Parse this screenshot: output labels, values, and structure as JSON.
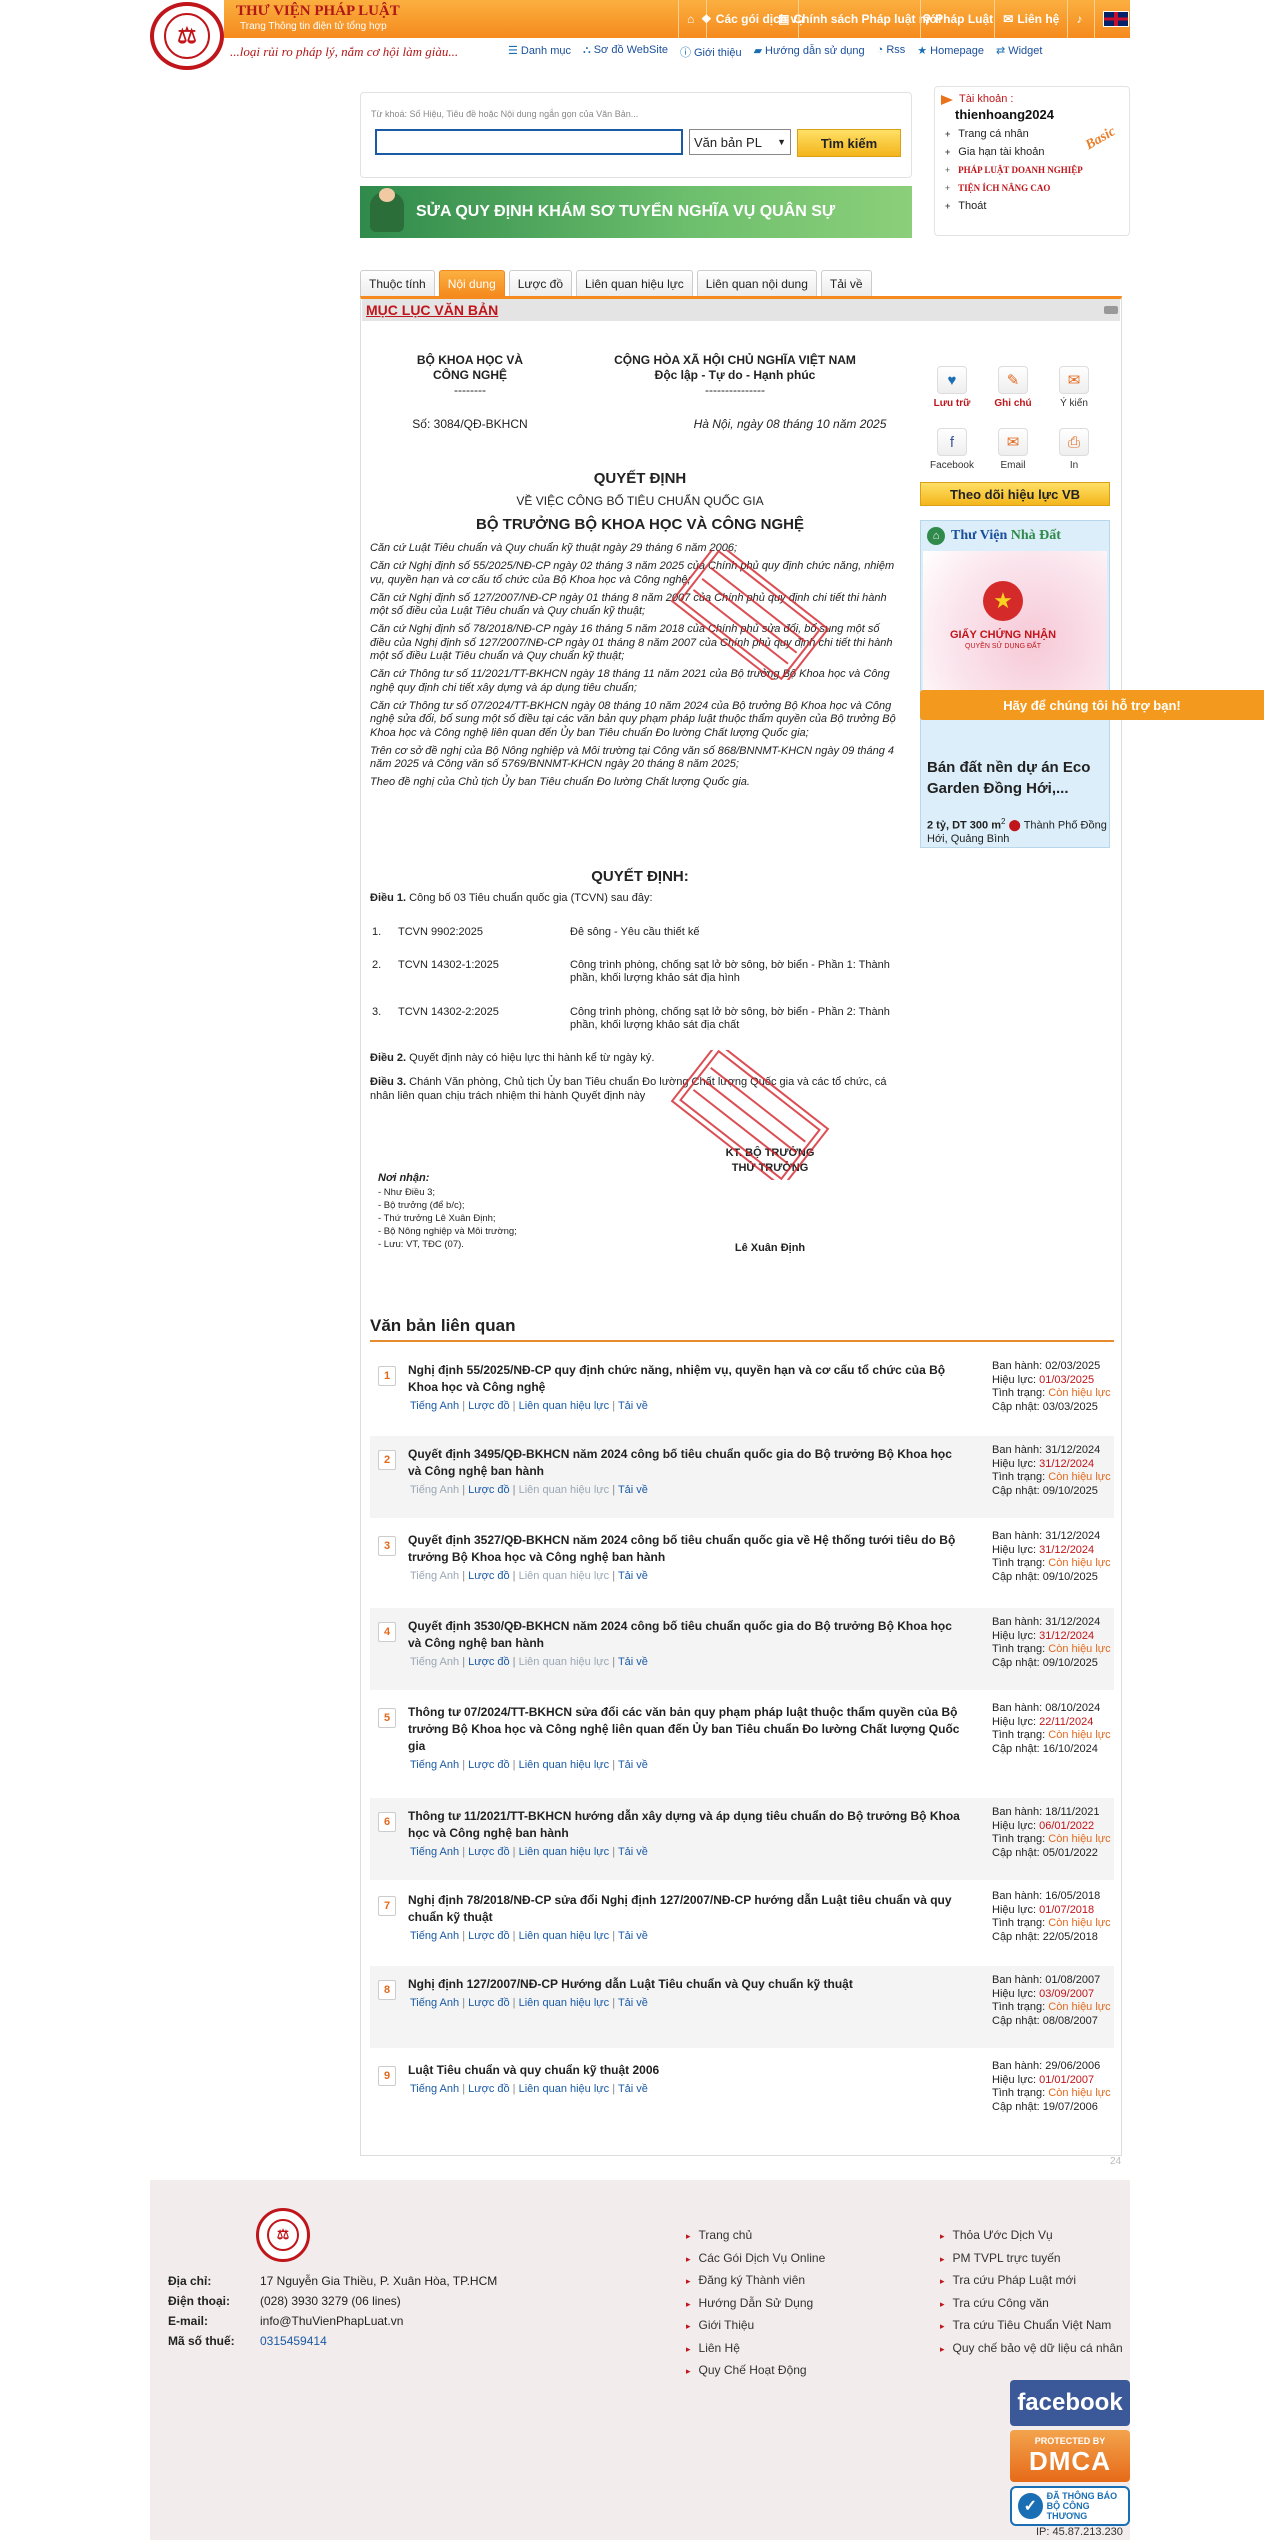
{
  "header": {
    "brand_title": "THƯ VIỆN PHÁP LUẬT",
    "brand_sub": "Trang Thông tin điện tử tổng hợp",
    "slogan": "...loại rủi ro pháp lý, nắm cơ hội làm giàu...",
    "nav": [
      {
        "icon": "home-icon",
        "glyph": "⌂",
        "label": ""
      },
      {
        "icon": "package-icon",
        "glyph": "❖",
        "label": "Các gói dịch vụ"
      },
      {
        "icon": "newspaper-icon",
        "glyph": "▤",
        "label": "Chính sách Pháp luật mới"
      },
      {
        "icon": "search-icon",
        "glyph": "⚲",
        "label": "Pháp Luật"
      },
      {
        "icon": "mail-icon",
        "glyph": "✉",
        "label": "Liên hệ"
      },
      {
        "icon": "bell-icon",
        "glyph": "♪",
        "label": ""
      },
      {
        "icon": "uk-flag-icon",
        "glyph": "",
        "label": ""
      }
    ],
    "subnav": [
      {
        "icon": "list-icon",
        "glyph": "☰",
        "label": "Danh mục"
      },
      {
        "icon": "sitemap-icon",
        "glyph": "⛬",
        "label": "Sơ đồ WebSite"
      },
      {
        "icon": "info-icon",
        "glyph": "ⓘ",
        "label": "Giới thiệu"
      },
      {
        "icon": "book-icon",
        "glyph": "▰",
        "label": "Hướng dẫn sử dụng"
      },
      {
        "icon": "rss-icon",
        "glyph": "◔",
        "label": "Rss"
      },
      {
        "icon": "star-icon",
        "glyph": "★",
        "label": "Homepage"
      },
      {
        "icon": "widget-icon",
        "glyph": "⇄",
        "label": "Widget"
      }
    ]
  },
  "search": {
    "hint": "Từ khoá: Số Hiệu, Tiêu đề hoặc Nội dung ngắn gọn của Văn Bản...",
    "value": "",
    "select_value": "Văn bản PL",
    "button": "Tìm kiếm"
  },
  "banner": {
    "text": "SỬA QUY ĐỊNH KHÁM SƠ TUYỂN NGHĨA VỤ QUÂN SỰ"
  },
  "account": {
    "label": "Tài khoản :",
    "username": "thienhoang2024",
    "badge": "Basic",
    "items": [
      "Trang cá nhân",
      "Gia hạn tài khoản",
      "PHÁP LUẬT DOANH NGHIỆP",
      "TIỆN ÍCH NÂNG CAO",
      "Thoát"
    ]
  },
  "tabs": [
    "Thuộc tính",
    "Nội dung",
    "Lược đồ",
    "Liên quan hiệu lực",
    "Liên quan nội dung",
    "Tải về"
  ],
  "toc_title": "MỤC LỤC VĂN BẢN",
  "document": {
    "agency_1": "BỘ KHOA HỌC VÀ",
    "agency_2": "CÔNG NGHỆ",
    "dashes_left": "--------",
    "nation": "CỘNG HÒA XÃ HỘI CHỦ NGHĨA VIỆT NAM",
    "motto": "Độc lập - Tự do - Hạnh phúc",
    "dashes_right": "---------------",
    "number": "Số: 3084/QĐ-BKHCN",
    "place_date": "Hà Nội, ngày 08 tháng 10 năm 2025",
    "type": "QUYẾT ĐỊNH",
    "subject": "VỀ VIỆC CÔNG BỐ TIÊU CHUẨN QUỐC GIA",
    "issuer": "BỘ TRƯỞNG BỘ KHOA HỌC VÀ CÔNG NGHỆ",
    "bases": [
      "Căn cứ Luật Tiêu chuẩn và Quy chuẩn kỹ thuật ngày 29 tháng 6 năm 2006;",
      "Căn cứ Nghị định số 55/2025/NĐ-CP ngày 02 tháng 3 năm 2025 của Chính phủ quy định chức năng, nhiệm vụ, quyền hạn và cơ cấu tổ chức của Bộ Khoa học và Công nghệ;",
      "Căn cứ Nghị định số 127/2007/NĐ-CP ngày 01 tháng 8 năm 2007 của Chính phủ quy định chi tiết thi hành một số điều của Luật Tiêu chuẩn và Quy chuẩn kỹ thuật;",
      "Căn cứ Nghị định số 78/2018/NĐ-CP ngày 16 tháng 5 năm 2018 của Chính phủ sửa đổi, bổ sung một số điều của Nghị định số 127/2007/NĐ-CP ngày 01 tháng 8 năm 2007 của Chính phủ quy định chi tiết thi hành một số điều Luật Tiêu chuẩn và Quy chuẩn kỹ thuật;",
      "Căn cứ Thông tư số 11/2021/TT-BKHCN ngày 18 tháng 11 năm 2021 của Bộ trưởng Bộ Khoa học và Công nghệ quy định chi tiết xây dựng và áp dụng tiêu chuẩn;",
      "Căn cứ Thông tư số 07/2024/TT-BKHCN ngày 08 tháng 10 năm 2024 của Bộ trưởng Bộ Khoa học và Công nghệ sửa đổi, bổ sung một số điều tại các văn bản quy phạm pháp luật thuộc thẩm quyền của Bộ trưởng Bộ Khoa học và Công nghệ liên quan đến Ủy ban Tiêu chuẩn Đo lường Chất lượng Quốc gia;",
      "Trên cơ sở đề nghị của Bộ Nông nghiệp và Môi trường tại Công văn số 868/BNNMT-KHCN ngày 09 tháng 4 năm 2025 và Công văn số 5769/BNNMT-KHCN ngày 20 tháng 8 năm 2025;",
      "Theo đề nghị của Chủ tịch Ủy ban Tiêu chuẩn Đo lường Chất lượng Quốc gia."
    ],
    "decides": "QUYẾT ĐỊNH:",
    "art1_label": "Điều 1.",
    "art1_text": " Công bố 03 Tiêu chuẩn quốc gia (TCVN) sau đây:",
    "standards": [
      {
        "no": "1.",
        "code": "TCVN 9902:2025",
        "name": "Đê sông - Yêu cầu thiết kế"
      },
      {
        "no": "2.",
        "code": "TCVN 14302-1:2025",
        "name": "Công trình phòng, chống sạt lở bờ sông, bờ biển - Phần 1: Thành phần, khối lượng khảo sát địa hình"
      },
      {
        "no": "3.",
        "code": "TCVN 14302-2:2025",
        "name": "Công trình phòng, chống sạt lở bờ sông, bờ biển - Phần 2: Thành phần, khối lượng khảo sát địa chất"
      }
    ],
    "art2_label": "Điều 2.",
    "art2_text": " Quyết định này có hiệu lực thi hành kể từ ngày ký.",
    "art3_label": "Điều 3.",
    "art3_text": " Chánh Văn phòng, Chủ tịch Ủy ban Tiêu chuẩn Đo lường Chất lượng Quốc gia và các tổ chức, cá nhân liên quan chịu trách nhiệm thi hành Quyết định này",
    "sign_title_1": "KT. BỘ TRƯỞNG",
    "sign_title_2": "THỨ TRƯỞNG",
    "signer": "Lê Xuân Định",
    "recipients_label": "Nơi nhận:",
    "recipients": [
      "- Như Điều 3;",
      "- Bộ trưởng (để b/c);",
      "- Thứ trưởng Lê Xuân Định;",
      "- Bộ Nông nghiệp và Môi trường;",
      "- Lưu: VT, TĐC (07)."
    ]
  },
  "actions": [
    {
      "icon": "save-icon",
      "glyph": "♥",
      "label": "Lưu trữ",
      "color": "#c0151a"
    },
    {
      "icon": "note-icon",
      "glyph": "✎",
      "label": "Ghi chú",
      "color": "#c0151a"
    },
    {
      "icon": "comment-icon",
      "glyph": "✉",
      "label": "Ý kiến",
      "color": "#333333"
    },
    {
      "icon": "facebook-icon",
      "glyph": "f",
      "label": "Facebook",
      "color": "#333333"
    },
    {
      "icon": "email-icon",
      "glyph": "✉",
      "label": "Email",
      "color": "#333333"
    },
    {
      "icon": "print-icon",
      "glyph": "⎙",
      "label": "In",
      "color": "#333333"
    }
  ],
  "follow_button": "Theo dõi hiệu lực VB",
  "ad": {
    "brand_1": "Thư Viện",
    "brand_2": "Nhà Đất",
    "cert_title": "GIẤY CHỨNG NHẬN",
    "cert_sub": "QUYỀN SỬ DỤNG ĐẤT",
    "support": "Hãy để chúng tôi hỗ trợ bạn!",
    "listing_title": "Bán đất nền dự án Eco Garden Đồng Hới,...",
    "price": "2 tỷ,",
    "area": "DT 300 m",
    "area_sup": "2",
    "location": "Thành Phố Đồng Hới, Quảng Bình"
  },
  "related": {
    "title": "Văn bản liên quan",
    "labels": {
      "issued": "Ban hành:",
      "effective": "Hiệu lực:",
      "status": "Tình trạng:",
      "updated": "Cập nhật:"
    },
    "link_labels": [
      "Tiếng Anh",
      "Lược đồ",
      "Liên quan hiệu lực",
      "Tải về"
    ],
    "items": [
      {
        "n": "1",
        "title": "Nghị định 55/2025/NĐ-CP quy định chức năng, nhiệm vụ, quyền hạn và cơ cấu tổ chức của Bộ Khoa học và Công nghệ",
        "issued": "02/03/2025",
        "effective": "01/03/2025",
        "status": "Còn hiệu lực",
        "updated": "03/03/2025"
      },
      {
        "n": "2",
        "title": "Quyết định 3495/QĐ-BKHCN năm 2024 công bố tiêu chuẩn quốc gia do Bộ trưởng Bộ Khoa học và Công nghệ ban hành",
        "issued": "31/12/2024",
        "effective": "31/12/2024",
        "status": "Còn hiệu lực",
        "updated": "09/10/2025"
      },
      {
        "n": "3",
        "title": "Quyết định 3527/QĐ-BKHCN năm 2024 công bố tiêu chuẩn quốc gia về Hệ thống tưới tiêu do Bộ trưởng Bộ Khoa học và Công nghệ ban hành",
        "issued": "31/12/2024",
        "effective": "31/12/2024",
        "status": "Còn hiệu lực",
        "updated": "09/10/2025"
      },
      {
        "n": "4",
        "title": "Quyết định 3530/QĐ-BKHCN năm 2024 công bố tiêu chuẩn quốc gia do Bộ trưởng Bộ Khoa học và Công nghệ ban hành",
        "issued": "31/12/2024",
        "effective": "31/12/2024",
        "status": "Còn hiệu lực",
        "updated": "09/10/2025"
      },
      {
        "n": "5",
        "title": "Thông tư 07/2024/TT-BKHCN sửa đổi các văn bản quy phạm pháp luật thuộc thẩm quyền của Bộ trưởng Bộ Khoa học và Công nghệ liên quan đến Ủy ban Tiêu chuẩn Đo lường Chất lượng Quốc gia",
        "issued": "08/10/2024",
        "effective": "22/11/2024",
        "status": "Còn hiệu lực",
        "updated": "16/10/2024"
      },
      {
        "n": "6",
        "title": "Thông tư 11/2021/TT-BKHCN hướng dẫn xây dựng và áp dụng tiêu chuẩn do Bộ trưởng Bộ Khoa học và Công nghệ ban hành",
        "issued": "18/11/2021",
        "effective": "06/01/2022",
        "status": "Còn hiệu lực",
        "updated": "05/01/2022"
      },
      {
        "n": "7",
        "title": "Nghị định 78/2018/NĐ-CP sửa đổi Nghị định 127/2007/NĐ-CP hướng dẫn Luật tiêu chuẩn và quy chuẩn kỹ thuật",
        "issued": "16/05/2018",
        "effective": "01/07/2018",
        "status": "Còn hiệu lực",
        "updated": "22/05/2018"
      },
      {
        "n": "8",
        "title": "Nghị định 127/2007/NĐ-CP Hướng dẫn Luật Tiêu chuẩn và Quy chuẩn kỹ thuật",
        "issued": "01/08/2007",
        "effective": "03/09/2007",
        "status": "Còn hiệu lực",
        "updated": "08/08/2007"
      },
      {
        "n": "9",
        "title": "Luật Tiêu chuẩn và quy chuẩn kỹ thuật 2006",
        "issued": "29/06/2006",
        "effective": "01/01/2007",
        "status": "Còn hiệu lực",
        "updated": "19/07/2006"
      }
    ]
  },
  "page_counter": "24",
  "footer": {
    "address_label": "Địa chỉ:",
    "address": "17 Nguyễn Gia Thiều, P. Xuân Hòa, TP.HCM",
    "phone_label": "Điện thoại:",
    "phone": "(028) 3930 3279 (06 lines)",
    "email_label": "E-mail:",
    "email": "info@ThuVienPhapLuat.vn",
    "tax_label": "Mã số thuế:",
    "tax": "0315459414",
    "links_col1": [
      "Trang chủ",
      "Các Gói Dịch Vụ Online",
      "Đăng ký Thành viên",
      "Hướng Dẫn Sử Dụng",
      "Giới Thiệu",
      "Liên Hệ",
      "Quy Chế Hoạt Động"
    ],
    "links_col2": [
      "Thỏa Ước Dịch Vụ",
      "PM TVPL trực tuyến",
      "Tra cứu Pháp Luật mới",
      "Tra cứu Công văn",
      "Tra cứu Tiêu Chuẩn Việt Nam",
      "Quy chế bảo vệ dữ liệu cá nhân"
    ],
    "fb_badge": "facebook",
    "dmca_top": "PROTECTED BY",
    "dmca": "DMCA",
    "bct_1": "ĐÃ THÔNG BÁO",
    "bct_2": "BỘ CÔNG THƯƠNG",
    "ip": "IP: 45.87.213.230"
  },
  "colors": {
    "accent": "#f58a1e",
    "brand_red": "#c0151a",
    "link": "#1a5aa5"
  }
}
